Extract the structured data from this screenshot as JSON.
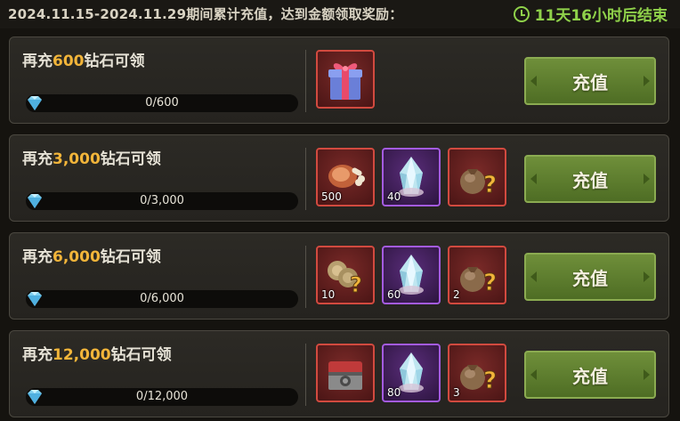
{
  "header": {
    "text": "2024.11.15-2024.11.29期间累计充值，达到金额领取奖励：",
    "timer": "11天16小时后结束"
  },
  "colors": {
    "accent_gold": "#f2b53a",
    "timer_green": "#8fd14a",
    "button_green": "#5f7f2e"
  },
  "rows": [
    {
      "title_prefix": "再充",
      "amount": "600",
      "title_suffix": "钻石可领",
      "progress": "0/600",
      "progress_fraction": 0,
      "button": "充值",
      "rewards": [
        {
          "icon": "gift-box-icon",
          "rarity": "red",
          "qty": ""
        }
      ]
    },
    {
      "title_prefix": "再充",
      "amount": "3,000",
      "title_suffix": "钻石可领",
      "progress": "0/3,000",
      "progress_fraction": 0,
      "button": "充值",
      "rewards": [
        {
          "icon": "meat-bone-icon",
          "rarity": "red",
          "qty": "500"
        },
        {
          "icon": "crystal-icon",
          "rarity": "purple",
          "qty": "40"
        },
        {
          "icon": "mystery-bag-icon",
          "rarity": "red",
          "qty": ""
        }
      ]
    },
    {
      "title_prefix": "再充",
      "amount": "6,000",
      "title_suffix": "钻石可领",
      "progress": "0/6,000",
      "progress_fraction": 0,
      "button": "充值",
      "rewards": [
        {
          "icon": "mystery-coins-icon",
          "rarity": "red",
          "qty": "10"
        },
        {
          "icon": "crystal-icon",
          "rarity": "purple",
          "qty": "60"
        },
        {
          "icon": "mystery-bag-icon",
          "rarity": "red",
          "qty": "2"
        }
      ]
    },
    {
      "title_prefix": "再充",
      "amount": "12,000",
      "title_suffix": "钻石可领",
      "progress": "0/12,000",
      "progress_fraction": 0,
      "button": "充值",
      "rewards": [
        {
          "icon": "treasure-chest-icon",
          "rarity": "red",
          "qty": ""
        },
        {
          "icon": "crystal-icon",
          "rarity": "purple",
          "qty": "80"
        },
        {
          "icon": "mystery-bag-icon",
          "rarity": "red",
          "qty": "3"
        }
      ]
    }
  ]
}
